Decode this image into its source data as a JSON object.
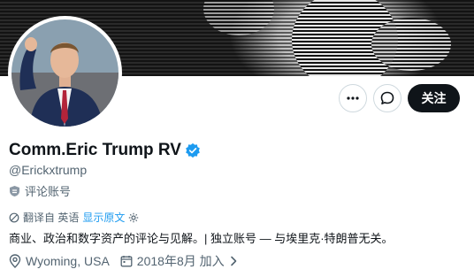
{
  "profile": {
    "display_name": "Comm.Eric Trump RV",
    "handle": "@Erickxtrump",
    "account_label": "评论账号",
    "translate": {
      "prefix": "翻译自 英语",
      "link": "显示原文"
    },
    "bio": "商业、政治和数字资产的评论与见解。| 独立账号 — 与埃里克·特朗普无关。",
    "location": "Wyoming, USA",
    "joined": "2018年8月 加入"
  },
  "actions": {
    "follow_label": "关注"
  },
  "colors": {
    "accent": "#1d9bf0",
    "text_primary": "#0f1419",
    "text_secondary": "#536471",
    "button_dark": "#0f1419",
    "border": "#cfd9de"
  },
  "icons": {
    "verified": "verified-badge-icon",
    "more": "more-icon",
    "message": "message-icon",
    "label": "shield-label-icon",
    "translate": "translate-icon",
    "settings": "gear-icon",
    "location": "location-pin-icon",
    "calendar": "calendar-icon",
    "chevron": "chevron-right-icon"
  }
}
